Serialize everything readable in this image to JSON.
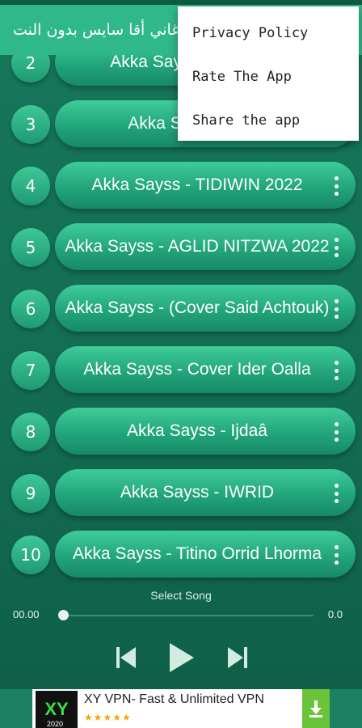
{
  "appbar": {
    "title": "أغاني أقا سايس بدون النت"
  },
  "overflow_menu": {
    "items": [
      {
        "label": "Privacy Policy"
      },
      {
        "label": "Rate The App"
      },
      {
        "label": "Share the app"
      }
    ]
  },
  "songs": [
    {
      "number": "2",
      "title": "Akka Sayss - Tamghart"
    },
    {
      "number": "3",
      "title": "Akka Sayss - Izgiz"
    },
    {
      "number": "4",
      "title": "Akka Sayss - TIDIWIN 2022"
    },
    {
      "number": "5",
      "title": "Akka Sayss - AGLID NITZWA 2022"
    },
    {
      "number": "6",
      "title": "Akka Sayss - (Cover Said Achtouk)"
    },
    {
      "number": "7",
      "title": "Akka Sayss - Cover Ider Oalla"
    },
    {
      "number": "8",
      "title": "Akka Sayss - Ijdaâ"
    },
    {
      "number": "9",
      "title": "Akka Sayss - IWRID"
    },
    {
      "number": "10",
      "title": "Akka Sayss - Titino Orrid Lhorma"
    }
  ],
  "player": {
    "status_label": "Select Song",
    "elapsed": "00.00",
    "duration": "0.0",
    "progress": 0,
    "icons": {
      "previous": "skip-previous-icon",
      "play": "play-icon",
      "next": "skip-next-icon"
    }
  },
  "ad": {
    "logo_text": "XY",
    "logo_sub": "2020",
    "title": "XY VPN- Fast & Unlimited VPN",
    "rating": "★★★★★",
    "download_icon": "download-icon"
  },
  "colors": {
    "background": "#136c52",
    "appbar": "#2fb88a",
    "pill": "#22a57b",
    "menu": "#ffffff",
    "ad_download": "#6bc33a"
  }
}
